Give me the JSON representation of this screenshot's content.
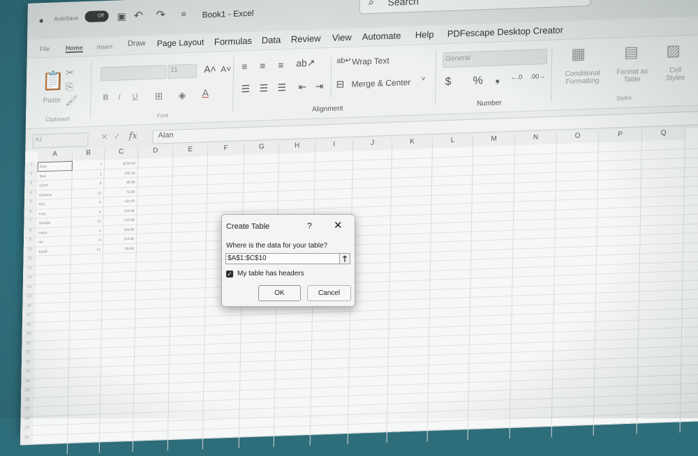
{
  "titlebar": {
    "autosave_label": "AutoSave",
    "autosave_state": "Off",
    "doc_title": "Book1 - Excel",
    "search_placeholder": "Search"
  },
  "menu": {
    "items": [
      "File",
      "Home",
      "Insert",
      "Draw",
      "Page Layout",
      "Formulas",
      "Data",
      "Review",
      "View",
      "Automate",
      "Help",
      "PDFescape Desktop Creator"
    ]
  },
  "ribbon": {
    "clipboard": {
      "paste_label": "Paste",
      "group_label": "Clipboard"
    },
    "font": {
      "size": "11",
      "group_label": "Font"
    },
    "alignment": {
      "wrap_text": "Wrap Text",
      "merge_center": "Merge & Center",
      "group_label": "Alignment"
    },
    "number": {
      "format": "General",
      "group_label": "Number"
    },
    "styles": {
      "conditional_formatting": "Conditional Formatting",
      "format_as_table": "Format as Table",
      "cell_styles": "Cell Styles",
      "group_label": "Styles"
    }
  },
  "formula_bar": {
    "name_box": "A1",
    "fx": "fx",
    "content": "Alan"
  },
  "grid": {
    "columns": [
      "A",
      "B",
      "C",
      "D",
      "E",
      "F",
      "G",
      "H",
      "I",
      "J",
      "K",
      "L",
      "M",
      "N",
      "O",
      "P",
      "Q"
    ],
    "rows": [
      {
        "a": "Alan",
        "b": "7",
        "c": "$129.99"
      },
      {
        "a": "Bob",
        "b": "2",
        "c": "255.49"
      },
      {
        "a": "Carol",
        "b": "5",
        "c": "89.99"
      },
      {
        "a": "Deanna",
        "b": "12",
        "c": "75.99"
      },
      {
        "a": "Eric",
        "b": "9",
        "c": "134.49"
      },
      {
        "a": "Fran",
        "b": "6",
        "c": "129.99"
      },
      {
        "a": "George",
        "b": "13",
        "c": "130.99"
      },
      {
        "a": "Harry",
        "b": "2",
        "c": "199.99"
      },
      {
        "a": "Ian",
        "b": "4",
        "c": "113.39"
      },
      {
        "a": "Jayde",
        "b": "12",
        "c": "99.99"
      }
    ]
  },
  "dialog": {
    "title": "Create Table",
    "help": "?",
    "close": "✕",
    "question": "Where is the data for your table?",
    "range": "$A$1:$C$10",
    "collapse_icon": "🡑",
    "checkbox_checked": "✓",
    "checkbox_label": "My table has headers",
    "ok": "OK",
    "cancel": "Cancel"
  }
}
